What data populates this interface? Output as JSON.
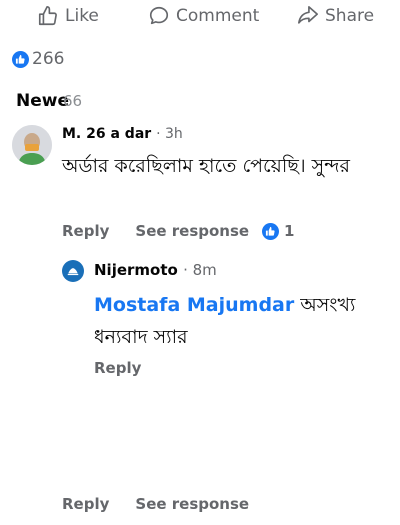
{
  "action_bar": {
    "like_label": "Like",
    "comment_label": "Comment",
    "share_label": "Share"
  },
  "reactions": {
    "count": "266",
    "icon": "like-icon",
    "color": "#1877f2"
  },
  "sort": {
    "label": "Newe",
    "ghost": "66"
  },
  "comment": {
    "author": "M​ 26 a​ ar",
    "author_display": "M. 26 a dar",
    "time": "· 3h",
    "text": "অর্ডার করেছিলাম হাতে পেয়েছি। সুন্দর",
    "reply_label": "Reply",
    "see_response_label": "See response",
    "like_count": "1"
  },
  "reply": {
    "author": "Nijermoto",
    "time": "· 8m",
    "mention": "Mostafa Majumdar",
    "text": " অসংখ্য ধন্যবাদ স্যার",
    "reply_label": "Reply"
  },
  "bottom_meta": {
    "reply_label": "Reply",
    "see_response_label": "See response"
  },
  "colors": {
    "accent": "#1877f2",
    "secondary_text": "#65676b"
  }
}
